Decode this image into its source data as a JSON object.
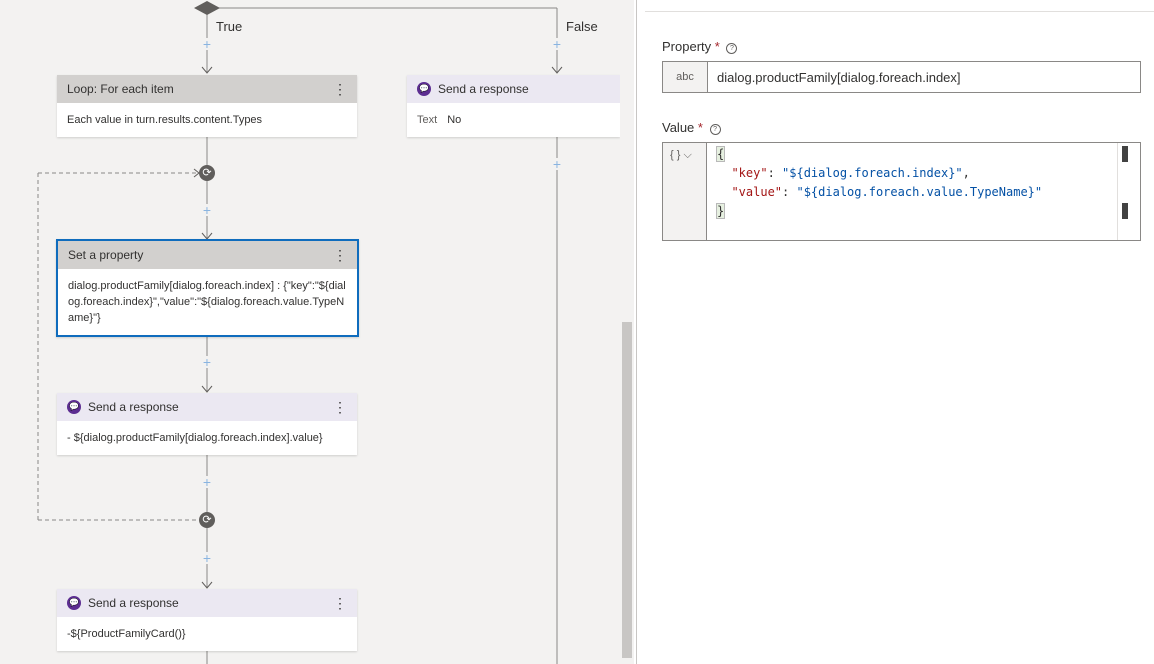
{
  "canvas": {
    "true_label": "True",
    "false_label": "False",
    "loop_card": {
      "title": "Loop: For each item",
      "body": "Each value in turn.results.content.Types"
    },
    "false_response": {
      "title": "Send a response",
      "text_label": "Text",
      "text_value": "No"
    },
    "set_property": {
      "title": "Set a property",
      "body": "dialog.productFamily[dialog.foreach.index] : {\"key\":\"${dialog.foreach.index}\",\"value\":\"${dialog.foreach.value.TypeName}\"}"
    },
    "response_loop": {
      "title": "Send a response",
      "body": "- ${dialog.productFamily[dialog.foreach.index].value}"
    },
    "response_card": {
      "title": "Send a response",
      "body": "-${ProductFamilyCard()}"
    },
    "menu_glyph": "⋮",
    "plus_glyph": "+",
    "loop_glyph": "⟳",
    "chat_glyph": "💬"
  },
  "panel": {
    "property": {
      "label": "Property",
      "required": "*",
      "help": "?",
      "type_chip": "abc",
      "value": "dialog.productFamily[dialog.foreach.index]"
    },
    "value": {
      "label": "Value",
      "required": "*",
      "help": "?",
      "type_chip": "{ } ⌵",
      "code": {
        "open": "{",
        "key1": "\"key\"",
        "val1": "\"${dialog.foreach.index}\"",
        "key2": "\"value\"",
        "val2": "\"${dialog.foreach.value.TypeName}\"",
        "close": "}"
      }
    }
  },
  "colors": {
    "canvas_bg": "#f3f2f1",
    "card_header_gray": "#d2d0ce",
    "card_header_lavender": "#ebe8f2",
    "selection_border": "#0f6cbd",
    "plus": "#8ab4e0",
    "chat_icon": "#5c2d91",
    "json_key": "#a31515",
    "json_string": "#0451a5"
  }
}
